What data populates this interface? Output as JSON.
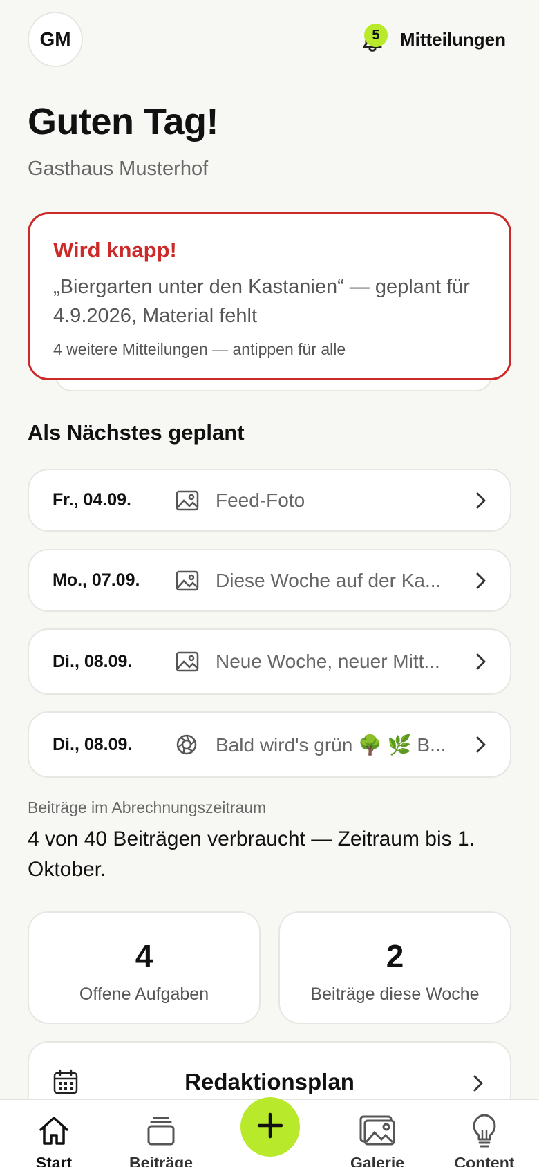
{
  "header": {
    "avatar_initials": "GM",
    "notifications_count": "5",
    "notifications_label": "Mitteilungen"
  },
  "greeting": "Guten Tag!",
  "business_name": "Gasthaus Musterhof",
  "alert": {
    "title": "Wird knapp!",
    "text": "„Biergarten unter den Kastanien“ — geplant für 4.9.2026, Material fehlt",
    "more": "4 weitere Mitteilungen — antippen für alle"
  },
  "planned": {
    "title": "Als Nächstes geplant",
    "items": [
      {
        "date": "Fr., 04.09.",
        "icon": "image-icon",
        "title": "Feed-Foto"
      },
      {
        "date": "Mo., 07.09.",
        "icon": "image-icon",
        "title": "Diese Woche auf der Ka..."
      },
      {
        "date": "Di., 08.09.",
        "icon": "image-icon",
        "title": "Neue Woche, neuer Mitt..."
      },
      {
        "date": "Di., 08.09.",
        "icon": "aperture-icon",
        "title": "Bald wird's grün 🌳 🌿  B..."
      }
    ]
  },
  "usage": {
    "label": "Beiträge im Abrechnungszeitraum",
    "text": "4 von 40 Beiträgen verbraucht — Zeitraum bis 1. Oktober."
  },
  "stats": [
    {
      "value": "4",
      "label": "Offene Aufgaben"
    },
    {
      "value": "2",
      "label": "Beiträge diese Woche"
    }
  ],
  "redaktionsplan": {
    "label": "Redaktionsplan"
  },
  "tabbar": {
    "tabs": [
      {
        "label": "Start",
        "icon": "home-icon",
        "active": true
      },
      {
        "label": "Beiträge",
        "icon": "stack-icon"
      },
      {
        "label": "Galerie",
        "icon": "gallery-icon"
      },
      {
        "label": "Content",
        "icon": "lightbulb-icon"
      }
    ],
    "fab_icon": "plus-icon"
  },
  "colors": {
    "accent": "#b8ea2b",
    "alert": "#cc2929",
    "background": "#f7f7f4"
  }
}
